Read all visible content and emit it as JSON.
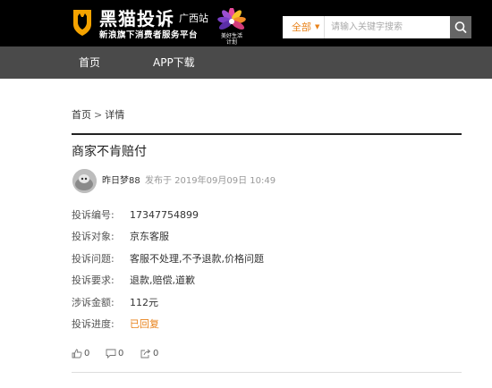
{
  "header": {
    "logo_title": "黑猫投诉",
    "logo_region": "广西站",
    "logo_slogan": "新浪旗下消费者服务平台",
    "partner_text_line1": "美好生活",
    "partner_text_line2": "计划",
    "search": {
      "scope_label": "全部",
      "placeholder": "请输入关键字搜索"
    }
  },
  "nav": {
    "items": [
      {
        "label": "首页"
      },
      {
        "label": "APP下载"
      }
    ]
  },
  "breadcrumb": {
    "home": "首页",
    "separator": ">",
    "current": "详情"
  },
  "complaint": {
    "title": "商家不肯赔付",
    "author": "昨日梦88",
    "posted_at": "发布于 2019年09月09日 10:49",
    "fields": [
      {
        "label": "投诉编号:",
        "value": "17347754899"
      },
      {
        "label": "投诉对象:",
        "value": "京东客服"
      },
      {
        "label": "投诉问题:",
        "value": "客服不处理,不予退款,价格问题"
      },
      {
        "label": "投诉要求:",
        "value": "退款,赔偿,道歉"
      },
      {
        "label": "涉诉金额:",
        "value": "112元"
      },
      {
        "label": "投诉进度:",
        "value": "已回复"
      }
    ],
    "actions": {
      "likes": "0",
      "comments": "0",
      "shares": "0"
    }
  },
  "colors": {
    "accent_orange": "#e8821a",
    "topbar_bg": "#000000",
    "navbar_bg": "#4a4a4a"
  },
  "icons": [
    "cat-shield-logo-icon",
    "flower-logo-icon",
    "search-icon",
    "thumbs-up-icon",
    "comment-icon",
    "share-icon"
  ]
}
